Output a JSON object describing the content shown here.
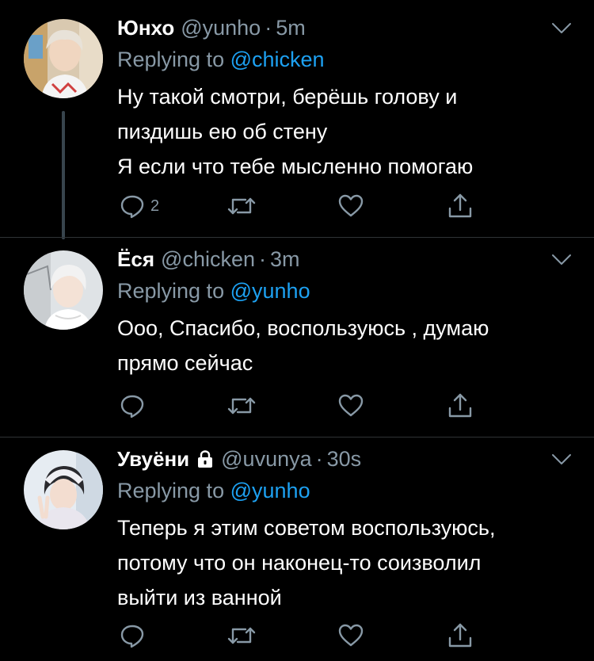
{
  "colors": {
    "background": "#000000",
    "text": "#ffffff",
    "secondary": "#8899a6",
    "link": "#1da1f2",
    "thread_line": "#38444d"
  },
  "tweets": [
    {
      "name": "Юнхо",
      "handle": "@yunho",
      "separator": "·",
      "time": "5m",
      "replying_prefix": "Replying to",
      "replying_to": "@chicken",
      "lines": [
        "Ну такой смотри, берёшь голову и",
        "пиздишь ею об стену",
        "Я если что тебе мысленно помогаю"
      ],
      "reply_count": "2",
      "protected": false
    },
    {
      "name": "Ёся",
      "handle": "@chicken",
      "separator": "·",
      "time": "3m",
      "replying_prefix": "Replying to",
      "replying_to": "@yunho",
      "lines": [
        "Ооо, Спасибо, воспользуюсь , думаю",
        "прямо сейчас"
      ],
      "reply_count": "",
      "protected": false
    },
    {
      "name": "Увуёни",
      "handle": "@uvunya",
      "separator": "·",
      "time": "30s",
      "replying_prefix": "Replying to",
      "replying_to": "@yunho",
      "lines": [
        "Теперь я этим советом воспользуюсь,",
        "потому что он наконец-то соизволил",
        "выйти из ванной"
      ],
      "reply_count": "",
      "protected": true
    }
  ],
  "icons": {
    "reply": "reply-icon",
    "retweet": "retweet-icon",
    "like": "heart-icon",
    "share": "share-icon",
    "more": "chevron-down-icon",
    "lock": "lock-icon"
  }
}
